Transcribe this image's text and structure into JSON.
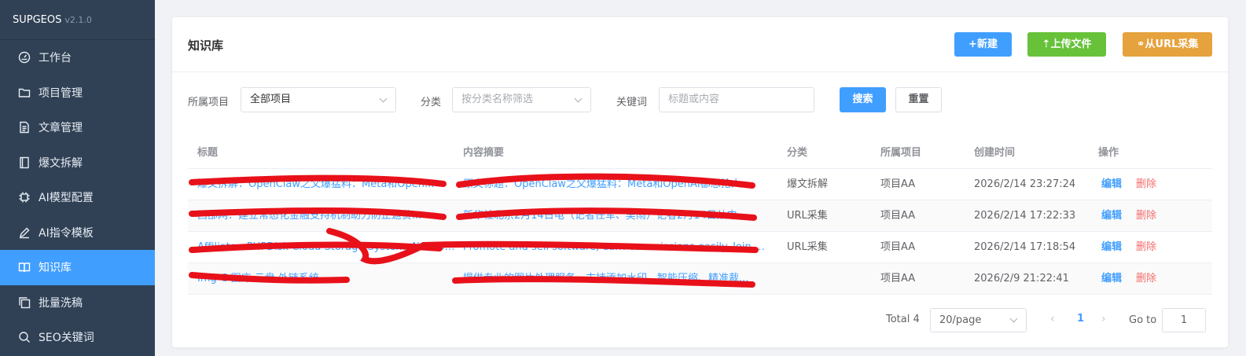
{
  "brand": {
    "name": "SUPGEOS",
    "version": "v2.1.0"
  },
  "sidebar": {
    "items": [
      {
        "label": "工作台",
        "icon": "dashboard-icon"
      },
      {
        "label": "项目管理",
        "icon": "folder-icon"
      },
      {
        "label": "文章管理",
        "icon": "document-icon"
      },
      {
        "label": "爆文拆解",
        "icon": "notebook-icon"
      },
      {
        "label": "AI模型配置",
        "icon": "cpu-icon"
      },
      {
        "label": "AI指令模板",
        "icon": "pen-icon"
      },
      {
        "label": "知识库",
        "icon": "book-icon",
        "active": true
      },
      {
        "label": "批量洗稿",
        "icon": "copy-icon"
      },
      {
        "label": "SEO关键词",
        "icon": "search-icon"
      }
    ]
  },
  "header": {
    "title": "知识库",
    "new_label": "+新建",
    "upload_label": "上传文件",
    "url_label": "从URL采集"
  },
  "filter": {
    "project_label": "所属项目",
    "project_value": "全部项目",
    "category_label": "分类",
    "category_placeholder": "按分类名称筛选",
    "keyword_label": "关键词",
    "keyword_placeholder": "标题或内容",
    "search_label": "搜索",
    "reset_label": "重置"
  },
  "table": {
    "columns": [
      "标题",
      "内容摘要",
      "分类",
      "所属项目",
      "创建时间",
      "操作"
    ],
    "rows": [
      {
        "title": "爆文拆解：OpenClaw之父爆猛料：Meta和Open...",
        "summary": "原文标题：OpenClaw之父爆猛料：Meta和OpenAI都想抢人...",
        "category": "爆文拆解",
        "project": "项目AA",
        "created": "2026/2/14 23:27:24"
      },
      {
        "title": "西部网：建立常态化金融支持机制助力防止返贫...",
        "summary": "新华社北京2月14日电（记者任军、吴雨）记者2月14日从中...",
        "category": "URL采集",
        "project": "项目AA",
        "created": "2026/2/14 17:22:33"
      },
      {
        "title": "Affiliate - PHPDisk Cloud Storage System, Networ...",
        "summary": "Promote and sell software, earn commissions easily. Join PHP...",
        "category": "URL采集",
        "project": "项目AA",
        "created": "2026/2/14 17:18:54"
      },
      {
        "title": "Img-C 图床 云盘 外链系统",
        "summary": "提供专业的图片处理服务，支持添加水印、智能压缩、精准裁...",
        "category": "",
        "project": "项目AA",
        "created": "2026/2/9 21:22:41"
      }
    ],
    "edit_label": "编辑",
    "delete_label": "删除"
  },
  "pagination": {
    "total": "Total 4",
    "page_size": "20/page",
    "current_page": "1",
    "goto_label": "Go to",
    "goto_value": "1"
  },
  "colors": {
    "sidebar_bg": "#304156",
    "primary": "#409eff",
    "success": "#67c23a",
    "warning": "#e6a23c",
    "danger": "#f56c6c",
    "redaction": "#e8111a"
  }
}
